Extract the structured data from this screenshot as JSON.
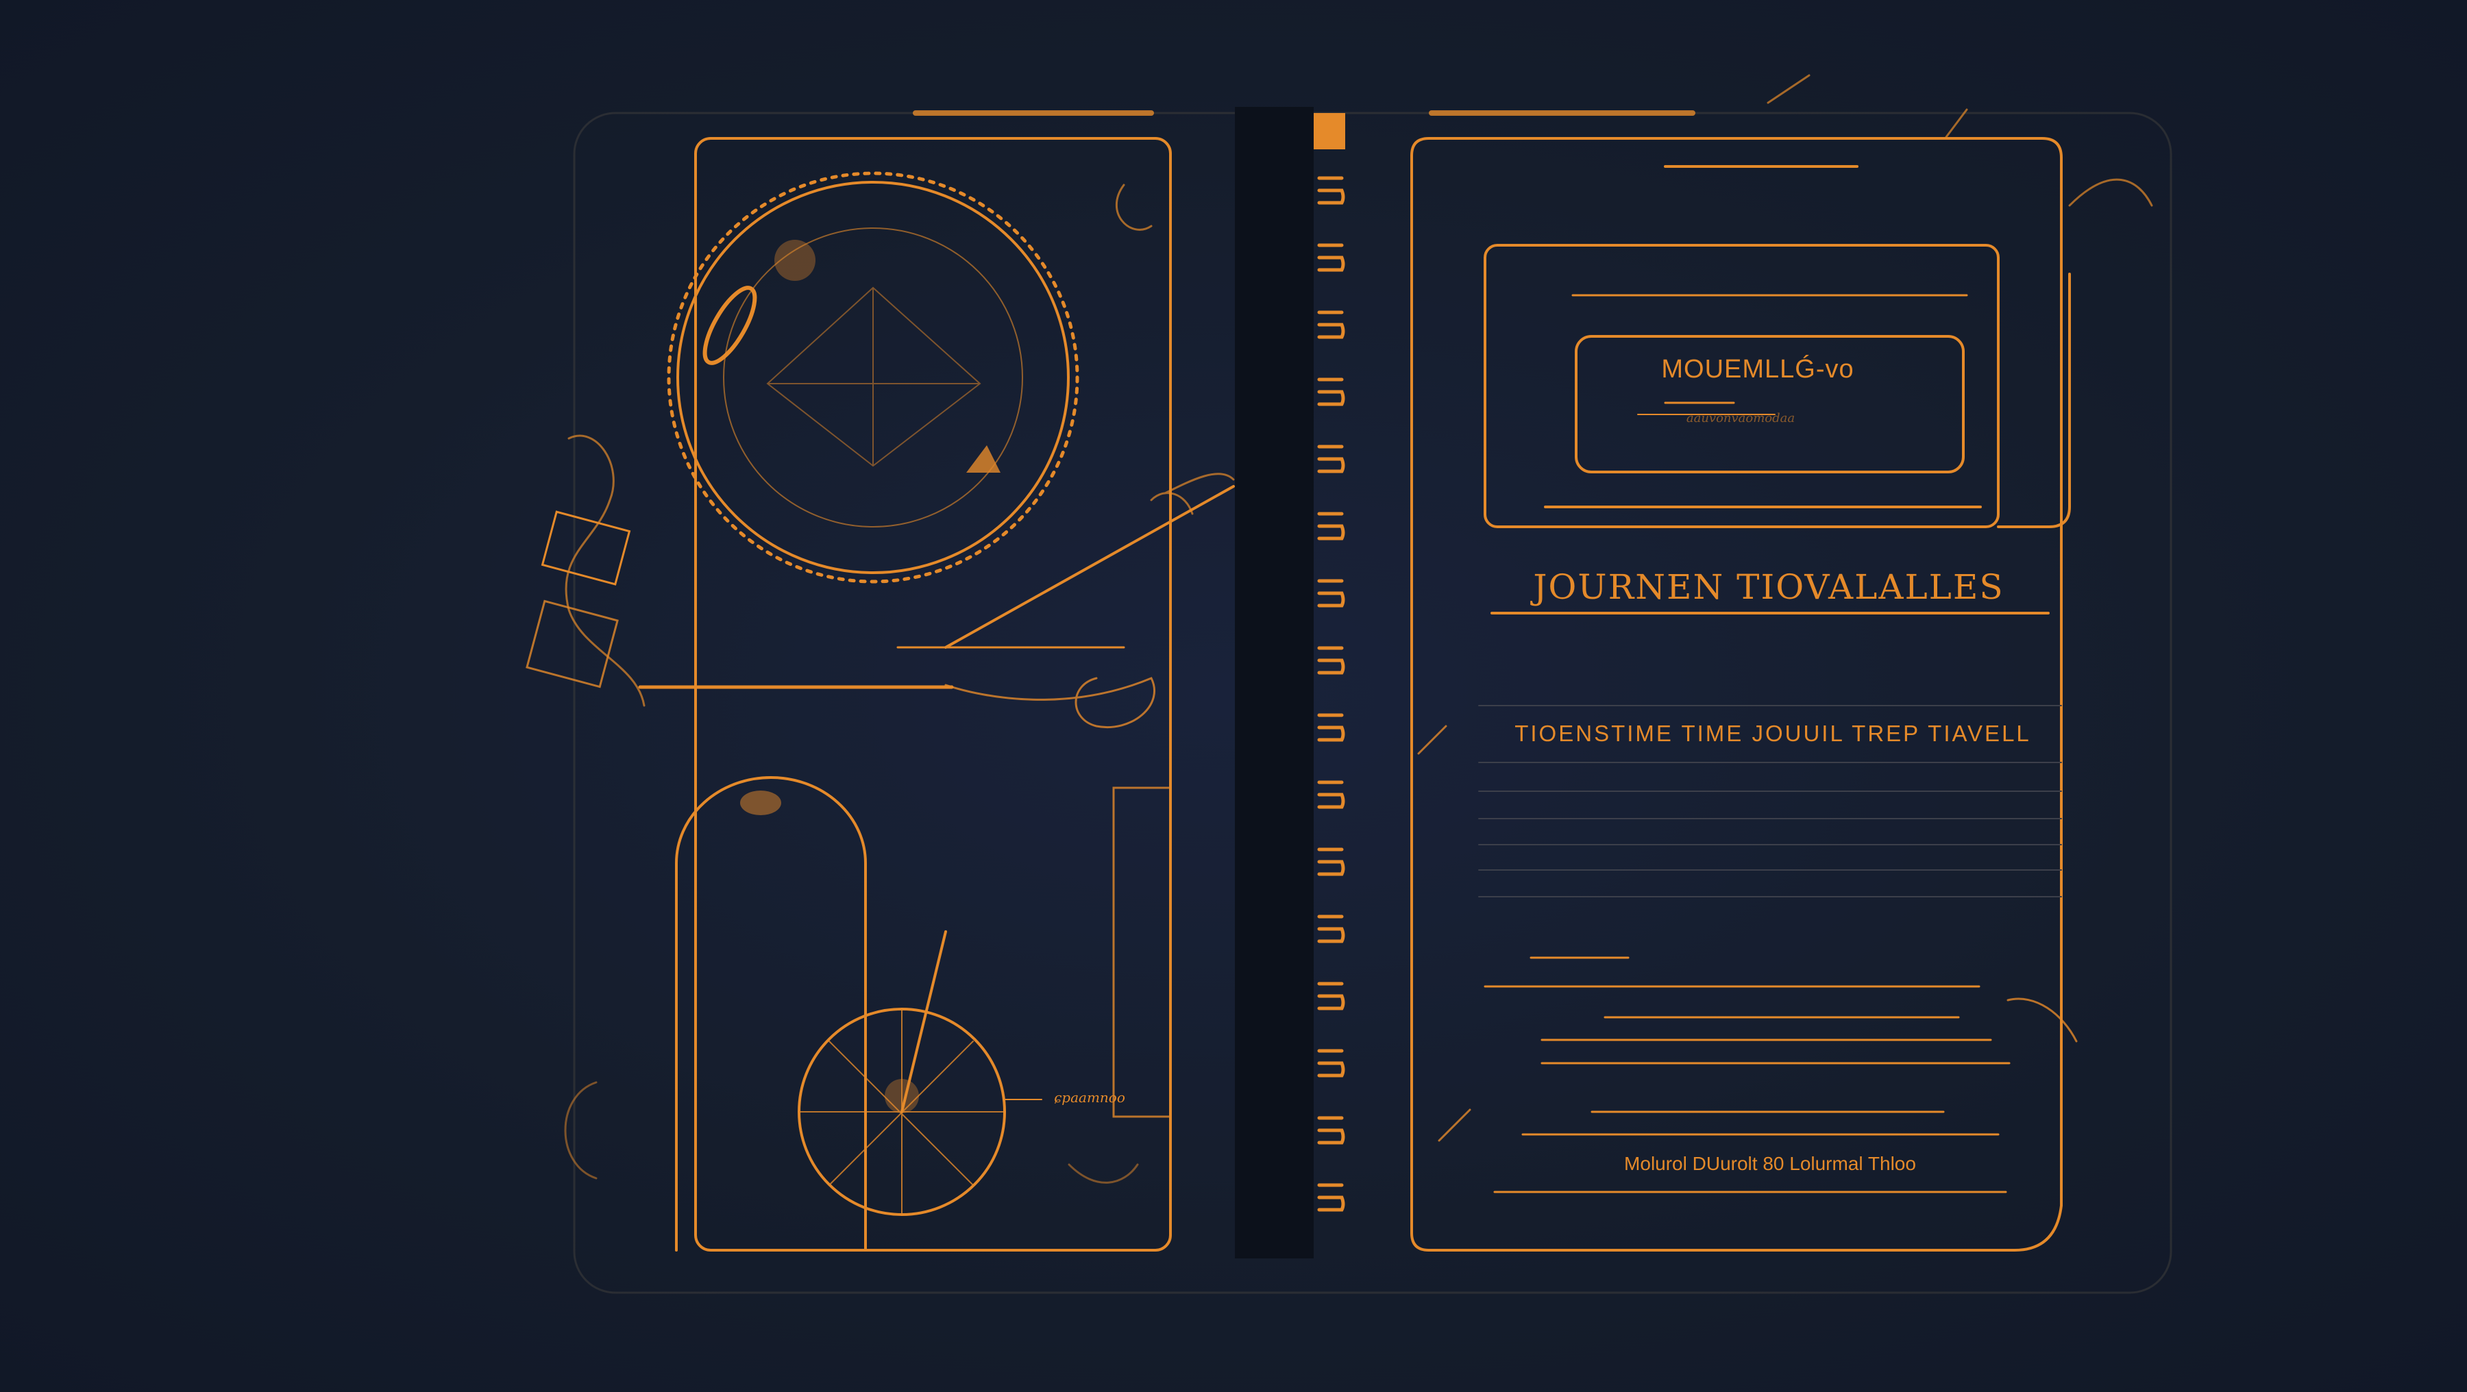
{
  "colors": {
    "background": "#141c2a",
    "accent": "#e58a2a",
    "spine": "#0c111b"
  },
  "left_page": {
    "compass_label": "ɕpaamnoo"
  },
  "right_page": {
    "plate_title": "MOUEMLLǴ-vo",
    "plate_subtitle": "aauvonvaomodaa",
    "title": "JOURNEN TIOVALALLES",
    "subtitle": "TIOENSTIME TIME JOUUIL TREP TIAVELL",
    "footer": "Molurol DUurolt 80 Lolurmal Thloo"
  }
}
